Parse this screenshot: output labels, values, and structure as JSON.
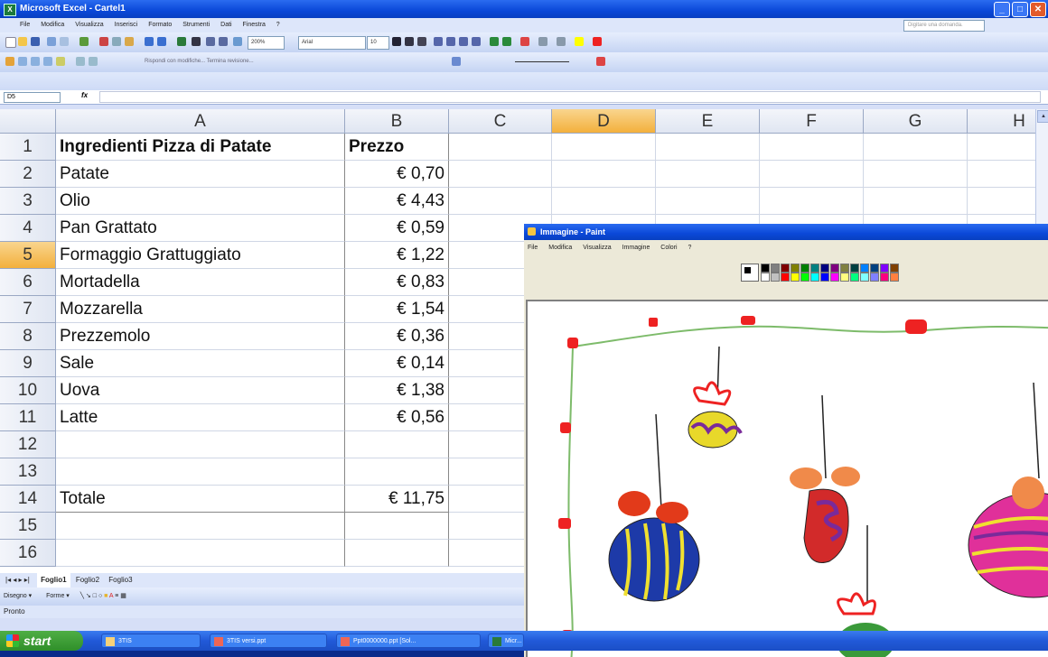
{
  "excel": {
    "title": "Microsoft Excel - Cartel1",
    "app_icon": "excel-icon",
    "menu": [
      "File",
      "Modifica",
      "Visualizza",
      "Inserisci",
      "Formato",
      "Strumenti",
      "Dati",
      "Finestra",
      "?"
    ],
    "help_placeholder": "Digitare una domanda.",
    "zoom": "200%",
    "font_name": "Arial",
    "font_size": "10",
    "review_bar_text": "Rispondi con modifiche...   Termina revisione...",
    "name_box": "D5",
    "fx_label": "fx",
    "columns": [
      "A",
      "B",
      "C",
      "D",
      "E",
      "F",
      "G",
      "H"
    ],
    "selected_column": "D",
    "selected_row": "5",
    "rows": [
      {
        "n": "1",
        "a": "Ingredienti Pizza di Patate",
        "b": "Prezzo",
        "bold": true
      },
      {
        "n": "2",
        "a": "Patate",
        "b": "€ 0,70"
      },
      {
        "n": "3",
        "a": "Olio",
        "b": "€ 4,43"
      },
      {
        "n": "4",
        "a": "Pan Grattato",
        "b": "€ 0,59"
      },
      {
        "n": "5",
        "a": "Formaggio Grattuggiato",
        "b": "€ 1,22"
      },
      {
        "n": "6",
        "a": "Mortadella",
        "b": "€ 0,83"
      },
      {
        "n": "7",
        "a": "Mozzarella",
        "b": "€ 1,54"
      },
      {
        "n": "8",
        "a": "Prezzemolo",
        "b": "€ 0,36"
      },
      {
        "n": "9",
        "a": "Sale",
        "b": "€ 0,14"
      },
      {
        "n": "10",
        "a": "Uova",
        "b": "€ 1,38"
      },
      {
        "n": "11",
        "a": "Latte",
        "b": "€ 0,56"
      },
      {
        "n": "12",
        "a": "",
        "b": ""
      },
      {
        "n": "13",
        "a": "",
        "b": ""
      },
      {
        "n": "14",
        "a": "Totale",
        "b": "€ 11,75"
      },
      {
        "n": "15",
        "a": "",
        "b": ""
      },
      {
        "n": "16",
        "a": "",
        "b": ""
      }
    ],
    "sheet_tabs": [
      "Foglio1",
      "Foglio2",
      "Foglio3"
    ],
    "active_sheet": "Foglio1",
    "draw_label": "Disegno ▾",
    "shapes_label": "Forme ▾",
    "status": "Pronto"
  },
  "paint": {
    "title": "Immagine - Paint",
    "menu": [
      "File",
      "Modifica",
      "Visualizza",
      "Immagine",
      "Colori",
      "?"
    ],
    "palette_top": [
      "#000000",
      "#808080",
      "#800000",
      "#808000",
      "#008000",
      "#008080",
      "#000080",
      "#800080",
      "#808040",
      "#004040",
      "#0080ff",
      "#004080",
      "#8000ff",
      "#804000"
    ],
    "palette_bottom": [
      "#ffffff",
      "#c0c0c0",
      "#ff0000",
      "#ffff00",
      "#00ff00",
      "#00ffff",
      "#0000ff",
      "#ff00ff",
      "#ffff80",
      "#00ff80",
      "#80ffff",
      "#8080ff",
      "#ff0080",
      "#ff8040"
    ]
  },
  "taskbar": {
    "start": "start",
    "tasks": [
      "3TIS",
      "3TIS versi.ppt",
      "Ppt0000000.ppt [Sol...",
      "Micr..."
    ]
  }
}
